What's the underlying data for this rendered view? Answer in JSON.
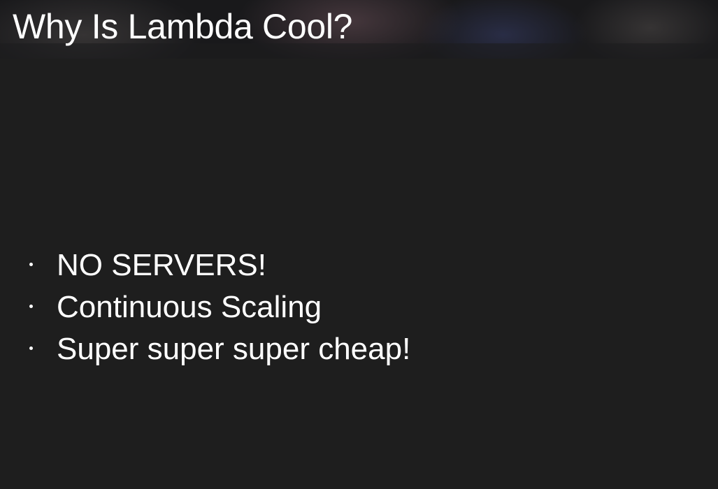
{
  "slide": {
    "title": "Why Is Lambda Cool?",
    "bullets": [
      "NO SERVERS!",
      "Continuous Scaling",
      "Super super super cheap!"
    ]
  },
  "colors": {
    "background": "#1e1e1e",
    "title_bar": "#1a1a1c",
    "text": "#ffffff"
  }
}
